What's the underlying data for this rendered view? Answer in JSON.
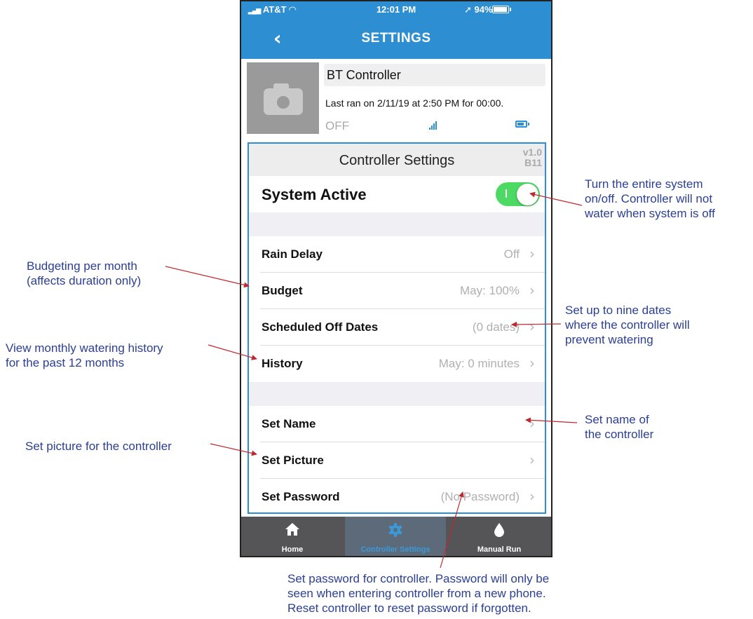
{
  "status_bar": {
    "carrier": "AT&T",
    "time": "12:01 PM",
    "battery_percent": "94%"
  },
  "nav": {
    "back_icon": "chevron-left-icon",
    "title": "SETTINGS"
  },
  "controller": {
    "name": "BT Controller",
    "last_ran": "Last ran on 2/11/19 at 2:50 PM for 00:00.",
    "status": "OFF"
  },
  "settings": {
    "title": "Controller Settings",
    "version": "v1.0",
    "build": "B11",
    "system_active_label": "System Active",
    "system_active": true,
    "rows": [
      {
        "label": "Rain Delay",
        "value": "Off"
      },
      {
        "label": "Budget",
        "value": "May: 100%"
      },
      {
        "label": "Scheduled Off Dates",
        "value": "(0 dates)"
      },
      {
        "label": "History",
        "value": "May: 0 minutes"
      },
      {
        "label": "Set Name",
        "value": ""
      },
      {
        "label": "Set Picture",
        "value": ""
      },
      {
        "label": "Set Password",
        "value": "(No Password)"
      }
    ]
  },
  "tabs": [
    {
      "label": "Home",
      "icon": "home-icon",
      "active": false
    },
    {
      "label": "Controller Settings",
      "icon": "gear-icon",
      "active": true
    },
    {
      "label": "Manual Run",
      "icon": "water-drop-icon",
      "active": false
    }
  ],
  "annotations": {
    "system": [
      "Turn the entire system",
      "on/off. Controller will not",
      "water when system is off"
    ],
    "budget": [
      "Budgeting per month",
      "(affects duration only)"
    ],
    "offdates": [
      "Set up to nine dates",
      "where the controller will",
      "prevent watering"
    ],
    "history": [
      "View monthly watering history",
      "for the past 12 months"
    ],
    "setname": [
      "Set name of",
      "the controller"
    ],
    "setpicture": [
      "Set picture for the controller"
    ],
    "password": [
      "Set password for controller. Password will only be",
      "seen when entering controller from a new phone.",
      "Reset controller to reset password if forgotten."
    ]
  },
  "colors": {
    "nav_blue": "#2d8fd1",
    "toggle_green": "#4cd964",
    "annotation_text": "#2b3f93",
    "arrow_red": "#c0282d"
  }
}
